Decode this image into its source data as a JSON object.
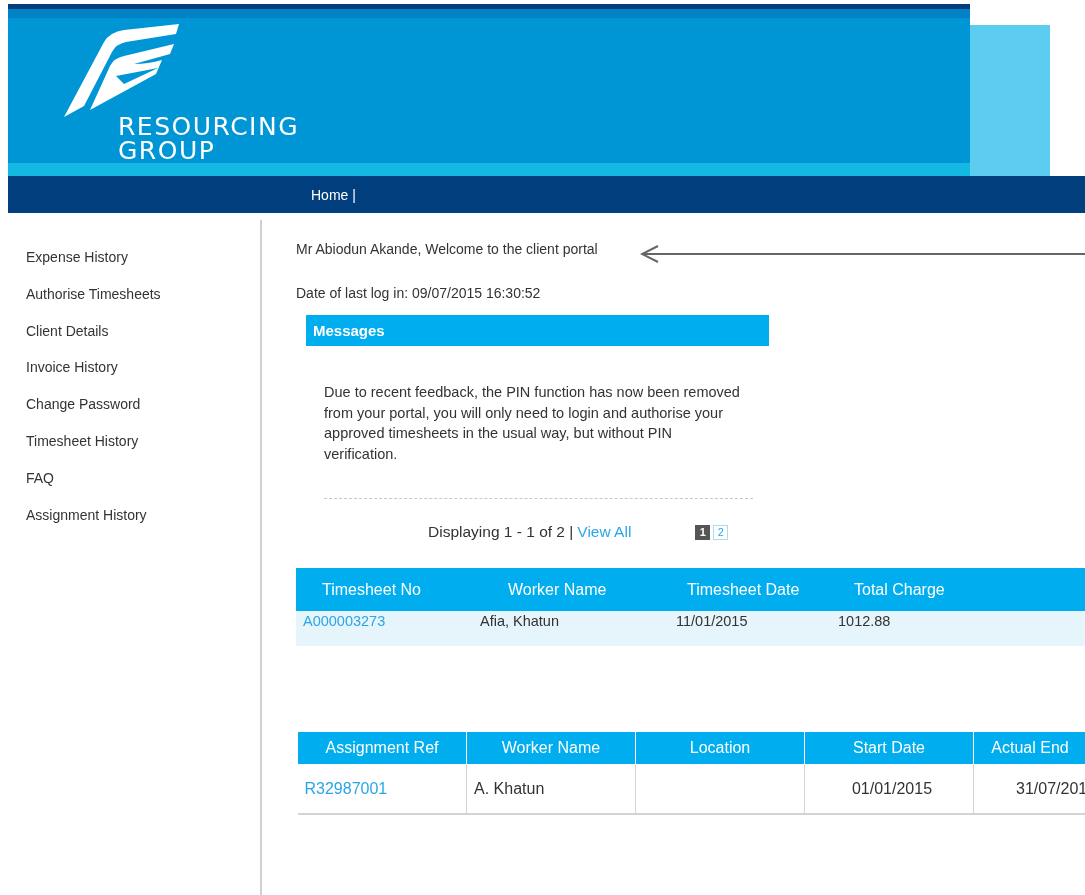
{
  "header": {
    "logo_lines": [
      "RESOURCING",
      "GROUP"
    ]
  },
  "nav": [
    {
      "label": "Home |"
    }
  ],
  "sidebar": {
    "items": [
      {
        "label": "Expense History"
      },
      {
        "label": "Authorise Timesheets"
      },
      {
        "label": "Client Details"
      },
      {
        "label": "Invoice History"
      },
      {
        "label": "Change Password"
      },
      {
        "label": "Timesheet History"
      },
      {
        "label": "FAQ"
      },
      {
        "label": "Assignment History"
      }
    ]
  },
  "welcome": "Mr Abiodun Akande, Welcome to the client portal",
  "last_login": "Date of last log in: 09/07/2015 16:30:52",
  "messages": {
    "title": "Messages",
    "text": "Due to recent feedback, the PIN function has now been removed from your portal, you will only need to login and authorise your approved timesheets in the usual way, but without PIN verification.",
    "paging": {
      "text": "Displaying 1 - 1 of 2 |",
      "link": "View All",
      "pages": [
        {
          "label": "1",
          "selected": true
        },
        {
          "label": "2",
          "selected": false
        }
      ]
    }
  },
  "timesheets": {
    "columns": [
      "Timesheet No",
      "Worker Name",
      "Timesheet Date",
      "Total Charge"
    ],
    "rows": [
      [
        "A000003273",
        "Afia, Khatun",
        "11/01/2015",
        "1012.88"
      ]
    ]
  },
  "assignments": {
    "columns": [
      "Assignment Ref",
      "Worker Name",
      "Location",
      "Start Date",
      "Actual End"
    ],
    "rows": [
      [
        "R32987001",
        "A. Khatun",
        "",
        "01/01/2015",
        "31/07/201"
      ]
    ]
  }
}
